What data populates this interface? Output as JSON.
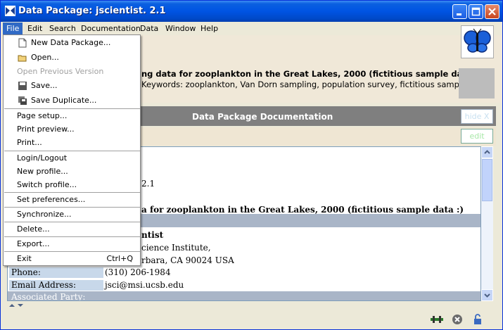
{
  "window": {
    "title": "Data Package:  jscientist. 2.1"
  },
  "menubar": {
    "items": [
      "File",
      "Edit",
      "Search",
      "Documentation",
      "Data",
      "Window",
      "Help"
    ]
  },
  "file_menu": {
    "new_package": "New Data Package...",
    "open": "Open...",
    "open_previous": "Open Previous Version",
    "save": "Save...",
    "save_duplicate": "Save Duplicate...",
    "page_setup": "Page setup...",
    "print_preview": "Print preview...",
    "print": "Print...",
    "login": "Login/Logout",
    "new_profile": "New profile...",
    "switch_profile": "Switch profile...",
    "set_preferences": "Set preferences...",
    "synchronize": "Synchronize...",
    "delete": "Delete...",
    "export": "Export...",
    "exit": "Exit",
    "exit_shortcut": "Ctrl+Q"
  },
  "header": {
    "title_fragment": "ng data for zooplankton in the Great Lakes, 2000 (fictitious sample data :)",
    "keywords_fragment": "Keywords: zooplankton, Van Dorn sampling, population survey, fictitious sample ..."
  },
  "doc_panel": {
    "title": "Data Package Documentation",
    "hide_label": "hide X",
    "edit_label": "edit"
  },
  "content": {
    "version_frag": "2.1",
    "title_frag": "a for zooplankton in the Great Lakes, 2000 (fictitious sample data :)",
    "name_frag": "ntist",
    "inst_frag": "cience Institute,",
    "addr_frag": "rbara, CA 90024 USA",
    "phone_label": "Phone:",
    "phone_value": "(310) 206-1984",
    "email_label": "Email Address:",
    "email_value": "jsci@msi.ucsb.edu",
    "associated_party": "Associated Party:"
  },
  "colors": {
    "titlebar": "#0054e3",
    "menu_highlight": "#316ac5",
    "band": "#a9b5c7",
    "doc_bar": "#7f7f7f"
  }
}
